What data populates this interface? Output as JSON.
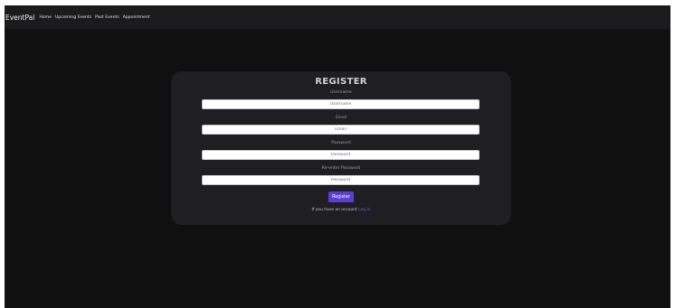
{
  "navbar": {
    "brand": "EventPal",
    "links": [
      "Home",
      "Upcoming Events",
      "Past Events",
      "Appointment"
    ]
  },
  "register_form": {
    "title": "REGISTER",
    "fields": [
      {
        "label": "Username",
        "placeholder": "Username"
      },
      {
        "label": "Email",
        "placeholder": "Email"
      },
      {
        "label": "Password",
        "placeholder": "Password"
      },
      {
        "label": "Re-enter Password",
        "placeholder": "Password"
      }
    ],
    "submit_label": "Register",
    "login_prompt": "If you have an account",
    "login_link": "Log In"
  },
  "colors": {
    "background": "#101011",
    "navbar": "#1b1b1e",
    "card": "#1f1f23",
    "accent_button": "#5a3ed6",
    "link": "#3d7dd8"
  }
}
